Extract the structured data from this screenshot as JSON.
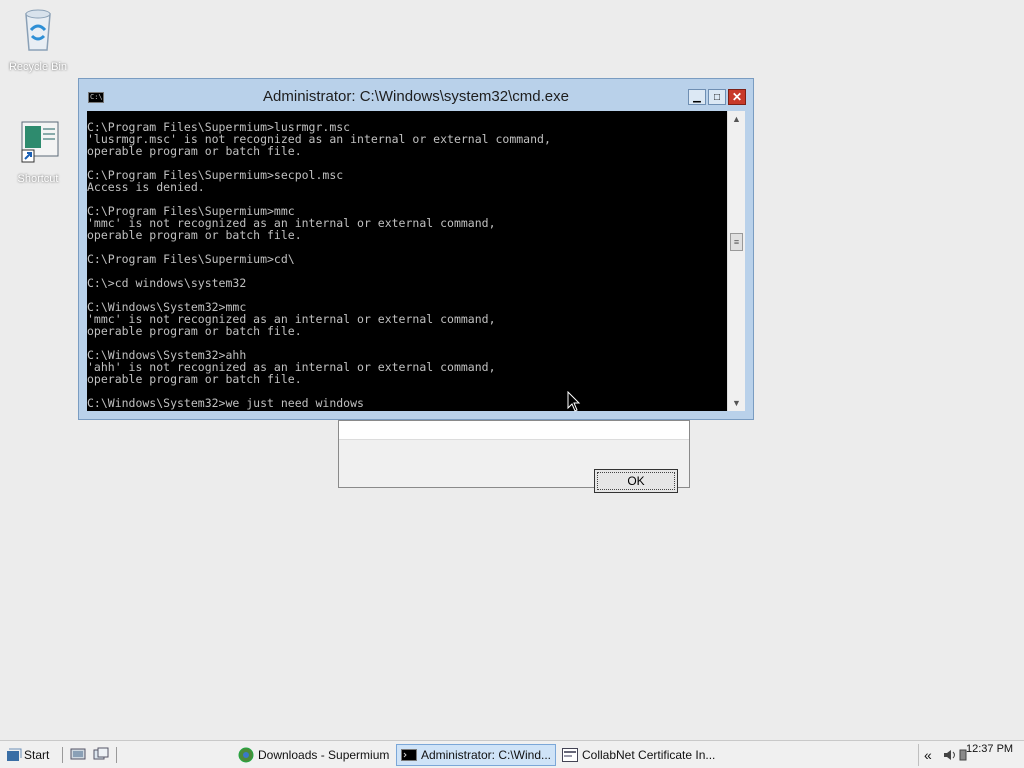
{
  "desktop": {
    "icons": [
      {
        "name": "recycle-bin",
        "label": "Recycle Bin"
      },
      {
        "name": "shortcut",
        "label": "Shortcut"
      }
    ]
  },
  "cmd_window": {
    "title": "Administrator: C:\\Windows\\system32\\cmd.exe",
    "icon_text": "C:\\",
    "controls": {
      "minimize": "▁",
      "maximize": "□",
      "close": "✕"
    },
    "lines": [
      "C:\\Program Files\\Supermium>lusrmgr.msc",
      "'lusrmgr.msc' is not recognized as an internal or external command,",
      "operable program or batch file.",
      "",
      "C:\\Program Files\\Supermium>secpol.msc",
      "Access is denied.",
      "",
      "C:\\Program Files\\Supermium>mmc",
      "'mmc' is not recognized as an internal or external command,",
      "operable program or batch file.",
      "",
      "C:\\Program Files\\Supermium>cd\\",
      "",
      "C:\\>cd windows\\system32",
      "",
      "C:\\Windows\\System32>mmc",
      "'mmc' is not recognized as an internal or external command,",
      "operable program or batch file.",
      "",
      "C:\\Windows\\System32>ahh",
      "'ahh' is not recognized as an internal or external command,",
      "operable program or batch file.",
      "",
      "C:\\Windows\\System32>we just need windows"
    ]
  },
  "dialog": {
    "ok_label": "OK"
  },
  "taskbar": {
    "start_label": "Start",
    "tasks": [
      {
        "label": "Downloads - Supermium",
        "icon": "browser-icon",
        "active": false
      },
      {
        "label": "Administrator: C:\\Wind...",
        "icon": "cmd-icon",
        "active": true
      },
      {
        "label": "CollabNet Certificate In...",
        "icon": "window-icon",
        "active": false
      }
    ],
    "tray": {
      "chevron": "«",
      "clock": "12:37 PM"
    }
  },
  "colors": {
    "console_bg": "#000000",
    "console_text": "#c0c0c0",
    "title_bar": "#b9d1ea",
    "close_button": "#c83a2a",
    "desktop": "#ececec"
  }
}
